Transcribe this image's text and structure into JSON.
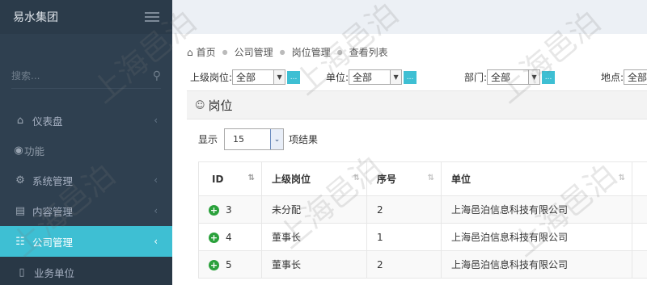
{
  "sidebar": {
    "brand": "易水集团",
    "search_placeholder": "搜索...",
    "items": [
      {
        "label": "仪表盘"
      },
      {
        "label": "功能"
      },
      {
        "label": "系统管理"
      },
      {
        "label": "内容管理"
      },
      {
        "label": "公司管理"
      },
      {
        "label": "业务单位"
      }
    ]
  },
  "breadcrumb": [
    "首页",
    "公司管理",
    "岗位管理",
    "查看列表"
  ],
  "filters": [
    {
      "label": "上级岗位:",
      "value": "全部"
    },
    {
      "label": "单位:",
      "value": "全部"
    },
    {
      "label": "部门:",
      "value": "全部"
    },
    {
      "label": "地点:",
      "value": "全部"
    }
  ],
  "panel": {
    "title": "岗位"
  },
  "length_menu": {
    "prefix": "显示",
    "value": "15",
    "suffix": "项结果"
  },
  "table": {
    "headers": [
      "ID",
      "上级岗位",
      "序号",
      "单位"
    ],
    "rows": [
      {
        "id": "3",
        "parent": "未分配",
        "seq": "2",
        "unit": "上海邑泊信息科技有限公司"
      },
      {
        "id": "4",
        "parent": "董事长",
        "seq": "1",
        "unit": "上海邑泊信息科技有限公司"
      },
      {
        "id": "5",
        "parent": "董事长",
        "seq": "2",
        "unit": "上海邑泊信息科技有限公司"
      }
    ]
  },
  "watermark": "上海邑泊",
  "colors": {
    "sidebar_bg": "#2f4050",
    "accent": "#3ebfd3",
    "expand_green": "#2aa13b"
  }
}
